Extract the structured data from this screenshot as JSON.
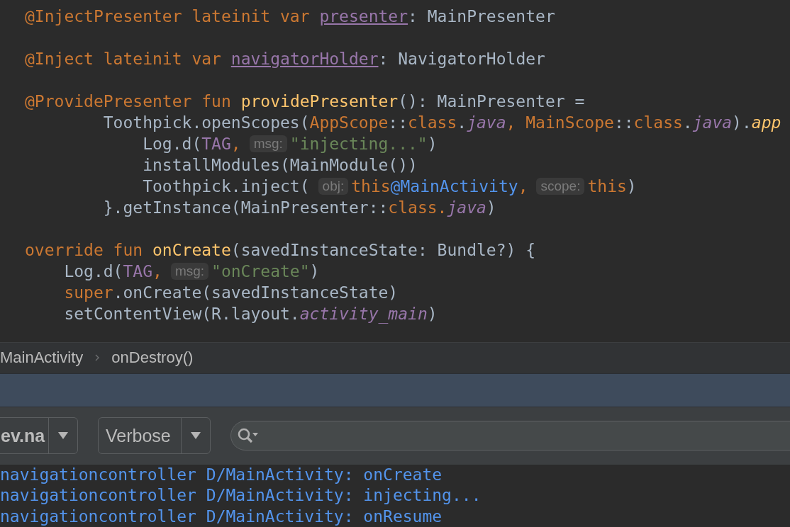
{
  "editor": {
    "lines": [
      {
        "kind": "code",
        "segments": [
          {
            "kind": "code",
            "tokens": [
              {
                "kind": "kw",
                "text": "@InjectPresenter lateinit var "
              },
              {
                "kind": "prop",
                "text": "presenter"
              },
              {
                "kind": "plain",
                "text": ": MainPresenter"
              }
            ]
          }
        ]
      },
      {
        "kind": "blank"
      },
      {
        "kind": "code",
        "segments": [
          {
            "kind": "code",
            "tokens": [
              {
                "kind": "kw",
                "text": "@Inject lateinit var "
              },
              {
                "kind": "prop",
                "text": "navigatorHolder"
              },
              {
                "kind": "plain",
                "text": ": NavigatorHolder"
              }
            ]
          }
        ]
      },
      {
        "kind": "blank"
      },
      {
        "kind": "code",
        "segments": [
          {
            "kind": "code",
            "tokens": [
              {
                "kind": "kw",
                "text": "@ProvidePresenter fun "
              },
              {
                "kind": "fn",
                "text": "providePresenter"
              },
              {
                "kind": "plain",
                "text": "(): MainPresenter ="
              }
            ]
          }
        ]
      },
      {
        "kind": "code",
        "segments": [
          {
            "kind": "code",
            "tokens": [
              {
                "kind": "plain",
                "text": "        Toothpick.openScopes("
              },
              {
                "kind": "kw",
                "text": "AppScope"
              },
              {
                "kind": "plain",
                "text": "::"
              },
              {
                "kind": "kw",
                "text": "class"
              },
              {
                "kind": "plain",
                "text": "."
              },
              {
                "kind": "italic",
                "text": "java"
              },
              {
                "kind": "kw",
                "text": ", MainScope"
              },
              {
                "kind": "plain",
                "text": "::"
              },
              {
                "kind": "kw",
                "text": "class"
              },
              {
                "kind": "plain",
                "text": "."
              },
              {
                "kind": "italic",
                "text": "java"
              },
              {
                "kind": "plain",
                "text": ")."
              },
              {
                "kind": "ext",
                "text": "app"
              }
            ]
          }
        ]
      },
      {
        "kind": "code",
        "segments": [
          {
            "kind": "code",
            "tokens": [
              {
                "kind": "plain",
                "text": "            Log.d("
              },
              {
                "kind": "field",
                "text": "TAG"
              },
              {
                "kind": "kw",
                "text": ","
              }
            ]
          },
          {
            "kind": "hint",
            "text": "msg:"
          },
          {
            "kind": "code",
            "tokens": [
              {
                "kind": "string",
                "text": "\"injecting...\""
              },
              {
                "kind": "plain",
                "text": ")"
              }
            ]
          }
        ]
      },
      {
        "kind": "code",
        "segments": [
          {
            "kind": "code",
            "tokens": [
              {
                "kind": "plain",
                "text": "            installModules(MainModule())"
              }
            ]
          }
        ]
      },
      {
        "kind": "code",
        "segments": [
          {
            "kind": "code",
            "tokens": [
              {
                "kind": "plain",
                "text": "            Toothpick.inject("
              }
            ]
          },
          {
            "kind": "hint",
            "text": "obj:"
          },
          {
            "kind": "code",
            "tokens": [
              {
                "kind": "kw",
                "text": "this"
              },
              {
                "kind": "label",
                "text": "@MainActivity"
              },
              {
                "kind": "kw",
                "text": ","
              }
            ]
          },
          {
            "kind": "hint",
            "text": "scope:"
          },
          {
            "kind": "code",
            "tokens": [
              {
                "kind": "kw",
                "text": "this"
              },
              {
                "kind": "plain",
                "text": ")"
              }
            ]
          }
        ]
      },
      {
        "kind": "code",
        "segments": [
          {
            "kind": "code",
            "tokens": [
              {
                "kind": "plain",
                "text": "        }.getInstance(MainPresenter::"
              },
              {
                "kind": "kw",
                "text": "class."
              },
              {
                "kind": "italic",
                "text": "java"
              },
              {
                "kind": "plain",
                "text": ")"
              }
            ]
          }
        ]
      },
      {
        "kind": "blank"
      },
      {
        "kind": "code",
        "segments": [
          {
            "kind": "code",
            "tokens": [
              {
                "kind": "kw",
                "text": "override fun "
              },
              {
                "kind": "fn",
                "text": "onCreate"
              },
              {
                "kind": "plain",
                "text": "(savedInstanceState: Bundle?) {"
              }
            ]
          }
        ]
      },
      {
        "kind": "code",
        "segments": [
          {
            "kind": "code",
            "tokens": [
              {
                "kind": "plain",
                "text": "    Log.d("
              },
              {
                "kind": "field",
                "text": "TAG"
              },
              {
                "kind": "kw",
                "text": ","
              }
            ]
          },
          {
            "kind": "hint",
            "text": "msg:"
          },
          {
            "kind": "code",
            "tokens": [
              {
                "kind": "string",
                "text": "\"onCreate\""
              },
              {
                "kind": "plain",
                "text": ")"
              }
            ]
          }
        ]
      },
      {
        "kind": "code",
        "segments": [
          {
            "kind": "code",
            "tokens": [
              {
                "kind": "kw",
                "text": "    super"
              },
              {
                "kind": "plain",
                "text": ".onCreate(savedInstanceState)"
              }
            ]
          }
        ]
      },
      {
        "kind": "code",
        "segments": [
          {
            "kind": "code",
            "tokens": [
              {
                "kind": "plain",
                "text": "    setContentView(R.layout."
              },
              {
                "kind": "italic",
                "text": "activity_main"
              },
              {
                "kind": "plain",
                "text": ")"
              }
            ]
          }
        ]
      }
    ]
  },
  "breadcrumbs": [
    "MainActivity",
    "onDestroy()"
  ],
  "logcat": {
    "process_filter": "ev.na",
    "level_filter": "Verbose",
    "lines": [
      "navigationcontroller D/MainActivity: onCreate",
      "navigationcontroller D/MainActivity: injecting...",
      "navigationcontroller D/MainActivity: onResume"
    ]
  }
}
